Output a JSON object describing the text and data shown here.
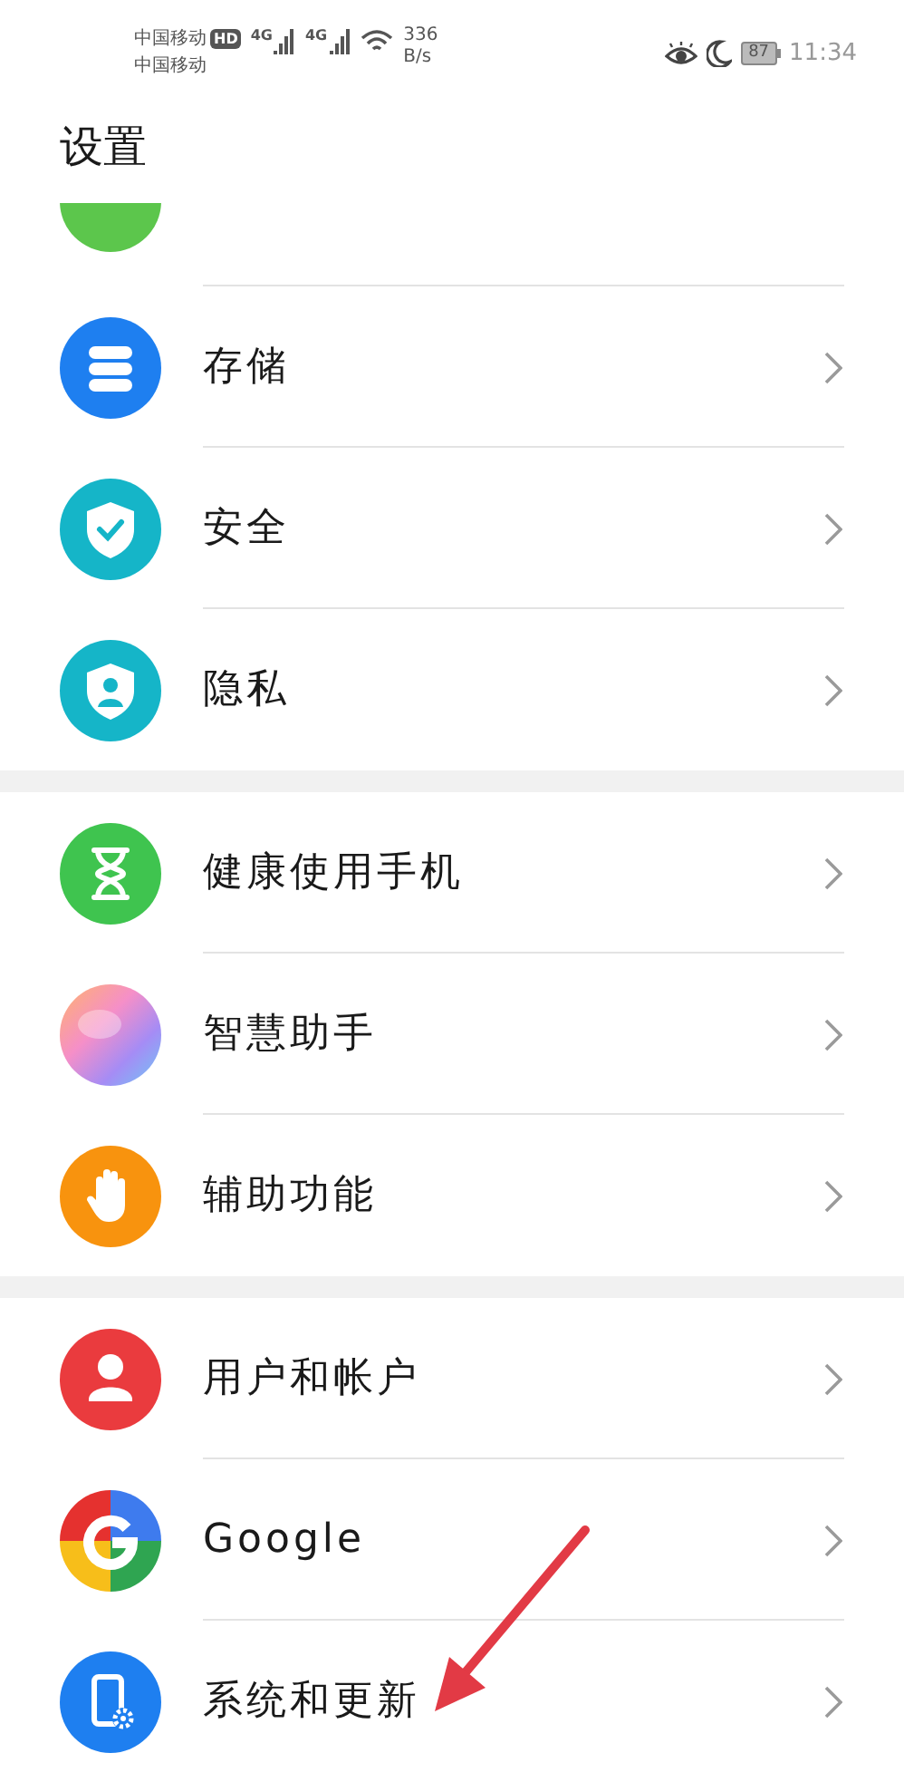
{
  "status_bar": {
    "carrier_1": "中国移动",
    "hd_badge": "HD",
    "network_1": "4G",
    "network_2": "4G",
    "speed": "336",
    "speed_unit": "B/s",
    "carrier_2": "中国移动",
    "battery": "87",
    "time": "11:34"
  },
  "title": "设置",
  "groups": [
    {
      "items": [
        {
          "kind": "battery",
          "cut": true
        },
        {
          "kind": "storage",
          "label": "存储",
          "cut": false
        },
        {
          "kind": "security",
          "label": "安全",
          "cut": false
        },
        {
          "kind": "privacy",
          "label": "隐私",
          "cut": false
        }
      ]
    },
    {
      "items": [
        {
          "kind": "health",
          "label": "健康使用手机",
          "cut": false
        },
        {
          "kind": "assistant",
          "label": "智慧助手",
          "cut": false
        },
        {
          "kind": "accessibility",
          "label": "辅助功能",
          "cut": false
        }
      ]
    },
    {
      "items": [
        {
          "kind": "user",
          "label": "用户和帐户",
          "cut": false
        },
        {
          "kind": "google",
          "label": "Google",
          "cut": false
        },
        {
          "kind": "system",
          "label": "系统和更新",
          "cut": false
        }
      ]
    }
  ],
  "annotation": {
    "kind": "arrow"
  }
}
